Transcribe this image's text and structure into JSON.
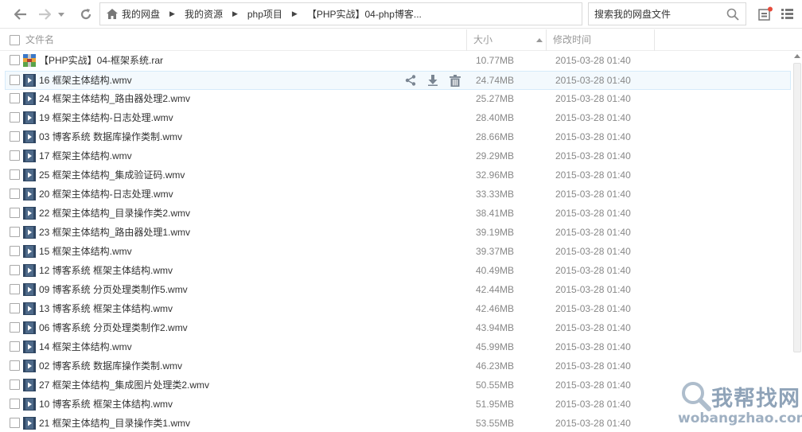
{
  "toolbar": {
    "back_icon": "arrow-left-icon",
    "forward_icon": "arrow-right-icon",
    "dropdown_icon": "caret-down-icon",
    "refresh_icon": "refresh-icon",
    "home_icon": "home-icon",
    "breadcrumb": [
      "我的网盘",
      "我的资源",
      "php项目",
      "【PHP实战】04-php博客..."
    ],
    "search_placeholder": "搜索我的网盘文件",
    "search_icon": "search-icon",
    "notification_icon": "notification-icon",
    "list_view_icon": "list-view-icon"
  },
  "header": {
    "name_label": "文件名",
    "size_label": "大小",
    "time_label": "修改时间"
  },
  "row_actions": {
    "share_icon": "share-icon",
    "download_icon": "download-icon",
    "delete_icon": "trash-icon"
  },
  "files": [
    {
      "name": "【PHP实战】04-框架系统.rar",
      "size": "10.77MB",
      "time": "2015-03-28 01:40",
      "type": "rar"
    },
    {
      "name": "16 框架主体结构.wmv",
      "size": "24.74MB",
      "time": "2015-03-28 01:40",
      "type": "video"
    },
    {
      "name": "24 框架主体结构_路由器处理2.wmv",
      "size": "25.27MB",
      "time": "2015-03-28 01:40",
      "type": "video"
    },
    {
      "name": "19 框架主体结构-日志处理.wmv",
      "size": "28.40MB",
      "time": "2015-03-28 01:40",
      "type": "video"
    },
    {
      "name": "03 博客系统 数据库操作类制.wmv",
      "size": "28.66MB",
      "time": "2015-03-28 01:40",
      "type": "video"
    },
    {
      "name": "17 框架主体结构.wmv",
      "size": "29.29MB",
      "time": "2015-03-28 01:40",
      "type": "video"
    },
    {
      "name": "25 框架主体结构_集成验证码.wmv",
      "size": "32.96MB",
      "time": "2015-03-28 01:40",
      "type": "video"
    },
    {
      "name": "20 框架主体结构-日志处理.wmv",
      "size": "33.33MB",
      "time": "2015-03-28 01:40",
      "type": "video"
    },
    {
      "name": "22 框架主体结构_目录操作类2.wmv",
      "size": "38.41MB",
      "time": "2015-03-28 01:40",
      "type": "video"
    },
    {
      "name": "23 框架主体结构_路由器处理1.wmv",
      "size": "39.19MB",
      "time": "2015-03-28 01:40",
      "type": "video"
    },
    {
      "name": "15 框架主体结构.wmv",
      "size": "39.37MB",
      "time": "2015-03-28 01:40",
      "type": "video"
    },
    {
      "name": "12 博客系统 框架主体结构.wmv",
      "size": "40.49MB",
      "time": "2015-03-28 01:40",
      "type": "video"
    },
    {
      "name": "09 博客系统 分页处理类制作5.wmv",
      "size": "42.44MB",
      "time": "2015-03-28 01:40",
      "type": "video"
    },
    {
      "name": "13 博客系统 框架主体结构.wmv",
      "size": "42.46MB",
      "time": "2015-03-28 01:40",
      "type": "video"
    },
    {
      "name": "06 博客系统 分页处理类制作2.wmv",
      "size": "43.94MB",
      "time": "2015-03-28 01:40",
      "type": "video"
    },
    {
      "name": "14 框架主体结构.wmv",
      "size": "45.99MB",
      "time": "2015-03-28 01:40",
      "type": "video"
    },
    {
      "name": "02 博客系统 数据库操作类制.wmv",
      "size": "46.23MB",
      "time": "2015-03-28 01:40",
      "type": "video"
    },
    {
      "name": "27 框架主体结构_集成图片处理类2.wmv",
      "size": "50.55MB",
      "time": "2015-03-28 01:40",
      "type": "video"
    },
    {
      "name": "10 博客系统 框架主体结构.wmv",
      "size": "51.95MB",
      "time": "2015-03-28 01:40",
      "type": "video"
    },
    {
      "name": "21 框架主体结构_目录操作类1.wmv",
      "size": "53.55MB",
      "time": "2015-03-28 01:40",
      "type": "video"
    }
  ],
  "watermark": {
    "text_cn": "我帮找网",
    "text_en": "wobangzhao.com"
  }
}
